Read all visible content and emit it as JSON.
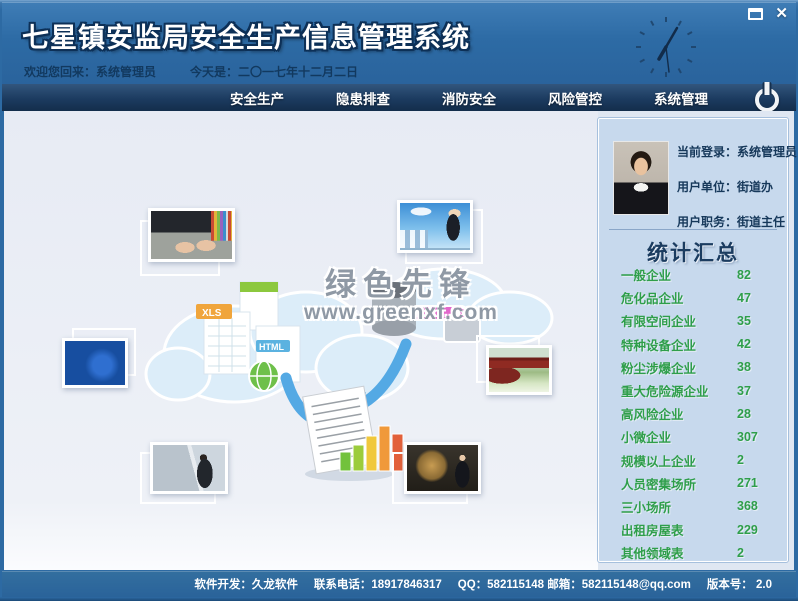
{
  "titlebar": {
    "title": "七星镇安监局安全生产信息管理系统",
    "welcome": "欢迎您回来：系统管理员",
    "date": "今天是：二〇一七年十二月二日",
    "close_glyph": "✕"
  },
  "nav": {
    "items": [
      {
        "label": "安全生产"
      },
      {
        "label": "隐患排查"
      },
      {
        "label": "消防安全"
      },
      {
        "label": "风险管控"
      },
      {
        "label": "系统管理"
      }
    ]
  },
  "main": {
    "watermark": {
      "line1": "绿色先锋",
      "line2": "www.greenxf.com"
    },
    "photos": [
      {
        "name": "typing-on-keyboard"
      },
      {
        "name": "businessman-with-laptop"
      },
      {
        "name": "globe-puzzle"
      },
      {
        "name": "red-mailbox"
      },
      {
        "name": "man-at-window-city"
      },
      {
        "name": "man-with-lightbulb"
      }
    ]
  },
  "sidebar": {
    "user": {
      "login": "当前登录：系统管理员",
      "unit": "用户单位：街道办",
      "position": "用户职务：街道主任"
    },
    "stats_title": "统计汇总",
    "stats": [
      {
        "label": "一般企业",
        "value": "82"
      },
      {
        "label": "危化品企业",
        "value": "47"
      },
      {
        "label": "有限空间企业",
        "value": "35"
      },
      {
        "label": "特种设备企业",
        "value": "42"
      },
      {
        "label": "粉尘涉爆企业",
        "value": "38"
      },
      {
        "label": "重大危险源企业",
        "value": "37"
      },
      {
        "label": "高风险企业",
        "value": "28"
      },
      {
        "label": "小微企业",
        "value": "307"
      },
      {
        "label": "规模以上企业",
        "value": "2"
      },
      {
        "label": "人员密集场所",
        "value": "271"
      },
      {
        "label": "三小场所",
        "value": "368"
      },
      {
        "label": "出租房屋表",
        "value": "229"
      },
      {
        "label": "其他领域表",
        "value": "2"
      }
    ]
  },
  "footer": {
    "dev": "软件开发：久龙软件",
    "phone": "联系电话：18917846317",
    "qq_mail": "QQ：582115148 邮箱：582115148@qq.com",
    "version": "版本号： 2.0"
  },
  "colors": {
    "titlebar_blue": "#2d6ba5",
    "nav_navy": "#1c3b60",
    "sidebar_bg": "#c7d9ed",
    "stat_green": "#2e9e4a",
    "heading_navy": "#1b3c60",
    "footer_blue": "#2d6aa3"
  }
}
